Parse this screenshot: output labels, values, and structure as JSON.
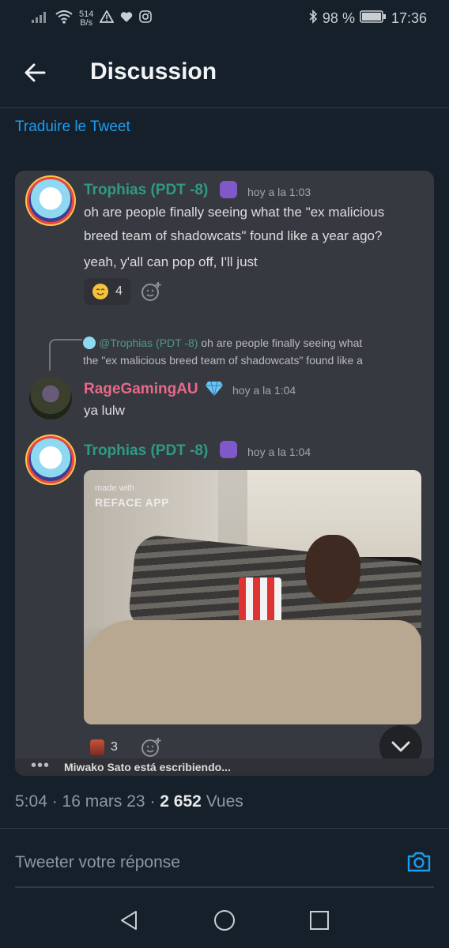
{
  "status_bar": {
    "net_speed_value": "514",
    "net_speed_unit": "B/s",
    "battery": "98 %",
    "time": "17:36"
  },
  "header": {
    "title": "Discussion"
  },
  "translate_link": "Traduire le Tweet",
  "discord": {
    "messages": [
      {
        "author": "Trophias (PDT -8)",
        "timestamp": "hoy a la 1:03",
        "lines": [
          "oh are people finally seeing what the \"ex malicious",
          "breed team of shadowcats\" found like a year ago?",
          "yeah, y'all can pop off, I'll just"
        ],
        "reaction_count": "4"
      },
      {
        "reply_mention": "@Trophias (PDT -8)",
        "reply_text_1": "oh are people finally seeing what",
        "reply_text_2": "the \"ex malicious breed team of shadowcats\" found like a",
        "author": "RageGamingAU",
        "timestamp": "hoy a la 1:04",
        "text": "ya lulw"
      },
      {
        "author": "Trophias (PDT -8)",
        "timestamp": "hoy a la 1:04",
        "watermark_1": "made with",
        "watermark_2": "REFACE APP",
        "reaction_count": "3"
      }
    ],
    "typing": "Miwako Sato está escribiendo..."
  },
  "tweet_meta": {
    "time": "5:04",
    "date": "16 mars 23",
    "views_count": "2 652",
    "views_label": "Vues"
  },
  "reply_placeholder": "Tweeter votre réponse",
  "icons": [
    "wifi-icon",
    "warning-icon",
    "heart-icon",
    "instagram-icon",
    "bluetooth-icon",
    "battery-icon",
    "back-arrow-icon",
    "camera-icon",
    "chevron-down-icon",
    "nav-back-icon",
    "nav-home-icon",
    "nav-recents-icon"
  ]
}
